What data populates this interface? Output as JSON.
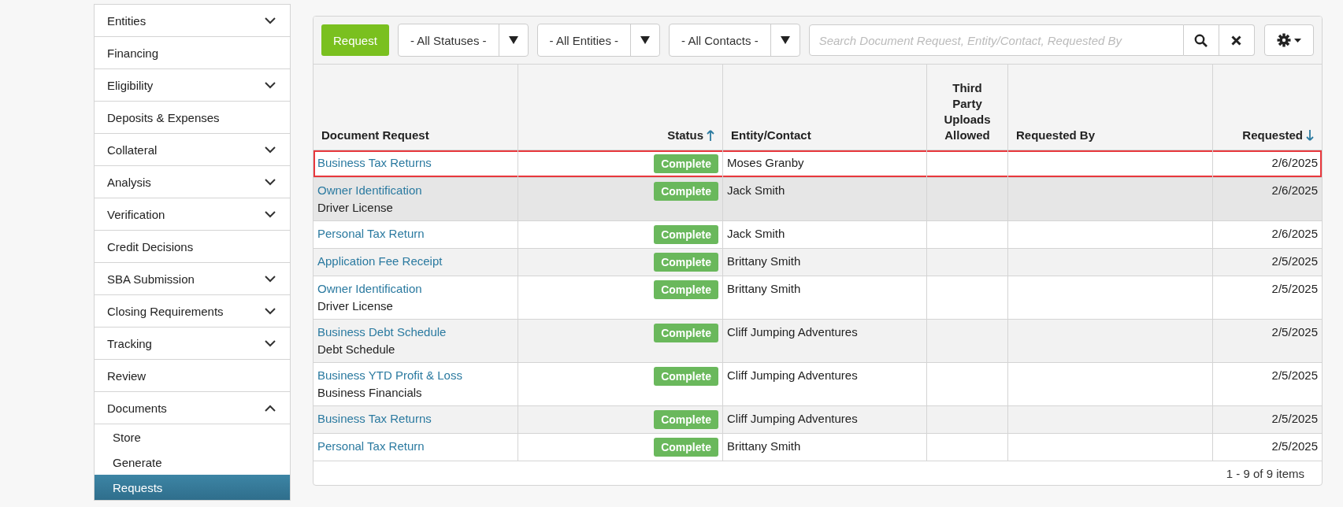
{
  "sidebar": {
    "items": [
      {
        "label": "Entities",
        "kind": "group",
        "expanded": false,
        "selected": false
      },
      {
        "label": "Financing",
        "kind": "link",
        "selected": false
      },
      {
        "label": "Eligibility",
        "kind": "group",
        "expanded": false,
        "selected": false
      },
      {
        "label": "Deposits & Expenses",
        "kind": "link",
        "selected": false
      },
      {
        "label": "Collateral",
        "kind": "group",
        "expanded": false,
        "selected": false
      },
      {
        "label": "Analysis",
        "kind": "group",
        "expanded": false,
        "selected": false
      },
      {
        "label": "Verification",
        "kind": "group",
        "expanded": false,
        "selected": false
      },
      {
        "label": "Credit Decisions",
        "kind": "link",
        "selected": false
      },
      {
        "label": "SBA Submission",
        "kind": "group",
        "expanded": false,
        "selected": false
      },
      {
        "label": "Closing Requirements",
        "kind": "group",
        "expanded": false,
        "selected": false
      },
      {
        "label": "Tracking",
        "kind": "group",
        "expanded": false,
        "selected": false
      },
      {
        "label": "Review",
        "kind": "link",
        "selected": false
      },
      {
        "label": "Documents",
        "kind": "group",
        "expanded": true,
        "selected": false,
        "children": [
          {
            "label": "Store",
            "selected": false
          },
          {
            "label": "Generate",
            "selected": false
          },
          {
            "label": "Requests",
            "selected": true
          }
        ]
      }
    ]
  },
  "toolbar": {
    "request_button": "Request",
    "filters": [
      {
        "label": "- All Statuses -"
      },
      {
        "label": "- All Entities -"
      },
      {
        "label": "- All Contacts -"
      }
    ],
    "search": {
      "placeholder": "Search Document Request, Entity/Contact, Requested By"
    }
  },
  "table": {
    "columns": [
      {
        "label": "Document Request",
        "sorted": false
      },
      {
        "label": "Status",
        "sorted": true,
        "ascending": true
      },
      {
        "label": "Entity/Contact",
        "sorted": false
      },
      {
        "label": "Third Party Uploads Allowed",
        "sorted": false
      },
      {
        "label": "Requested By",
        "sorted": false
      },
      {
        "label": "Requested",
        "sorted": true,
        "ascending": false
      }
    ],
    "rows": [
      {
        "document": "Business Tax Returns",
        "status": "Complete",
        "entity": "Moses Granby",
        "requested": "2/6/2025",
        "highlighted": true,
        "hovered": false
      },
      {
        "document": "Owner Identification",
        "detail": "Driver License",
        "status": "Complete",
        "entity": "Jack Smith",
        "requested": "2/6/2025",
        "highlighted": false,
        "hovered": true
      },
      {
        "document": "Personal Tax Return",
        "status": "Complete",
        "entity": "Jack Smith",
        "requested": "2/6/2025",
        "highlighted": false,
        "hovered": false
      },
      {
        "document": "Application Fee Receipt",
        "status": "Complete",
        "entity": "Brittany Smith",
        "requested": "2/5/2025",
        "highlighted": false,
        "hovered": false
      },
      {
        "document": "Owner Identification",
        "detail": "Driver License",
        "status": "Complete",
        "entity": "Brittany Smith",
        "requested": "2/5/2025",
        "highlighted": false,
        "hovered": false
      },
      {
        "document": "Business Debt Schedule",
        "detail": "Debt Schedule",
        "status": "Complete",
        "entity": "Cliff Jumping Adventures",
        "requested": "2/5/2025",
        "highlighted": false,
        "hovered": false
      },
      {
        "document": "Business YTD Profit & Loss",
        "detail": "Business Financials",
        "status": "Complete",
        "entity": "Cliff Jumping Adventures",
        "requested": "2/5/2025",
        "highlighted": false,
        "hovered": false
      },
      {
        "document": "Business Tax Returns",
        "status": "Complete",
        "entity": "Cliff Jumping Adventures",
        "requested": "2/5/2025",
        "highlighted": false,
        "hovered": false
      },
      {
        "document": "Personal Tax Return",
        "status": "Complete",
        "entity": "Brittany Smith",
        "requested": "2/5/2025",
        "highlighted": false,
        "hovered": false
      }
    ],
    "pager": "1 - 9 of 9 items"
  }
}
